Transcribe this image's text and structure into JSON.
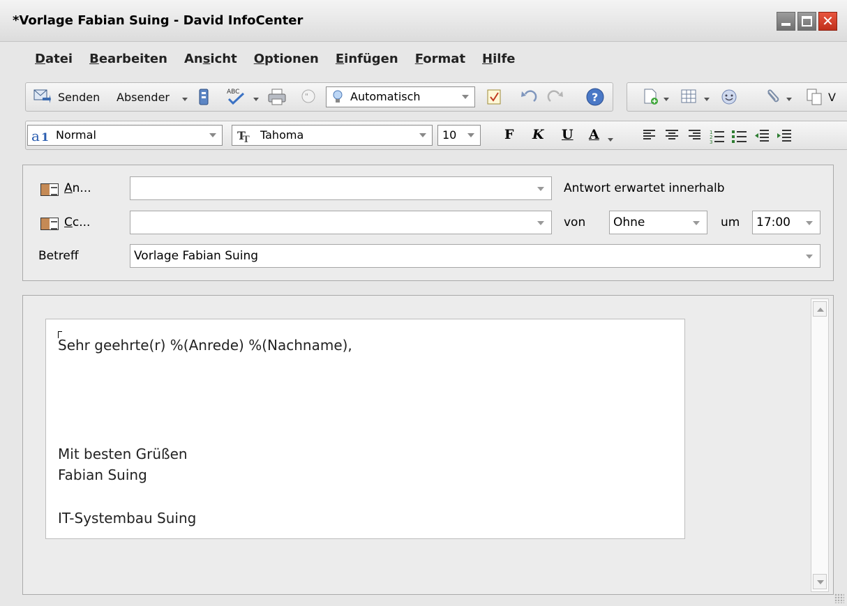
{
  "window": {
    "title": "*Vorlage Fabian Suing - David InfoCenter"
  },
  "menu": [
    {
      "pre": "",
      "mn": "D",
      "post": "atei"
    },
    {
      "pre": "",
      "mn": "B",
      "post": "earbeiten"
    },
    {
      "pre": "An",
      "mn": "s",
      "post": "icht"
    },
    {
      "pre": "",
      "mn": "O",
      "post": "ptionen"
    },
    {
      "pre": "",
      "mn": "E",
      "post": "infügen"
    },
    {
      "pre": "",
      "mn": "F",
      "post": "ormat"
    },
    {
      "pre": "",
      "mn": "H",
      "post": "ilfe"
    }
  ],
  "toolbar": {
    "send_label": "Senden",
    "sender_label": "Absender",
    "priority_value": "Automatisch",
    "overflow_label": "V"
  },
  "format": {
    "style_value": "Normal",
    "font_value": "Tahoma",
    "size_value": "10",
    "bold": "F",
    "italic": "K",
    "underline": "U",
    "color": "A"
  },
  "header": {
    "to_label_mn": "A",
    "to_label_rest": "n...",
    "cc_label_mn": "C",
    "cc_label_rest": "c...",
    "subject_label": "Betreff",
    "to_value": "",
    "cc_value": "",
    "subject_value": "Vorlage Fabian Suing",
    "reply_expected_label": "Antwort erwartet innerhalb",
    "from_label": "von",
    "period_value": "Ohne",
    "at_label": "um",
    "time_value": "17:00"
  },
  "body": {
    "greeting": "Sehr geehrte(r) %(Anrede) %(Nachname),",
    "closing": "Mit besten Grüßen",
    "name": "Fabian Suing",
    "company": "IT-Systembau Suing"
  },
  "colors": {
    "close_button": "#d63c25",
    "window_bg": "#e7e7e7"
  }
}
